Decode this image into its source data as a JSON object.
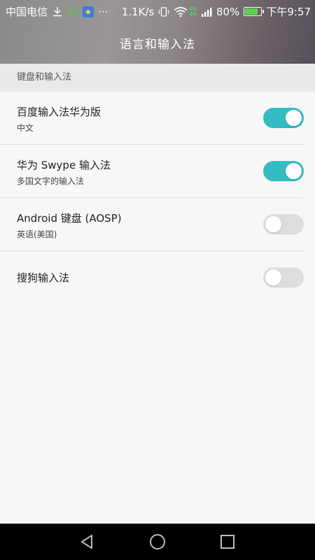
{
  "status_bar": {
    "carrier": "中国电信",
    "download_icon": "download-arrow-icon",
    "message_icon": "message-icon",
    "app_icon": "star-app-icon",
    "more": "···",
    "speed": "1.1K/s",
    "network_top": "4G",
    "network_bottom": "2G",
    "battery_percent": "80%",
    "battery_level": 0.8,
    "time": "下午9:57"
  },
  "title_bar": {
    "title": "语言和输入法"
  },
  "section": {
    "header": "键盘和输入法"
  },
  "input_methods": [
    {
      "title": "百度输入法华为版",
      "subtitle": "中文",
      "enabled": true
    },
    {
      "title": "华为 Swype 输入法",
      "subtitle": "多国文字的输入法",
      "enabled": true
    },
    {
      "title": "Android 键盘 (AOSP)",
      "subtitle": "英语(美国)",
      "enabled": false
    },
    {
      "title": "搜狗输入法",
      "subtitle": "",
      "enabled": false
    }
  ],
  "colors": {
    "toggle_on": "#34bcc0",
    "toggle_off": "#dddddd",
    "battery": "#58d34c"
  },
  "nav_bar": {
    "back": "back-icon",
    "home": "home-icon",
    "recent": "recent-apps-icon"
  }
}
